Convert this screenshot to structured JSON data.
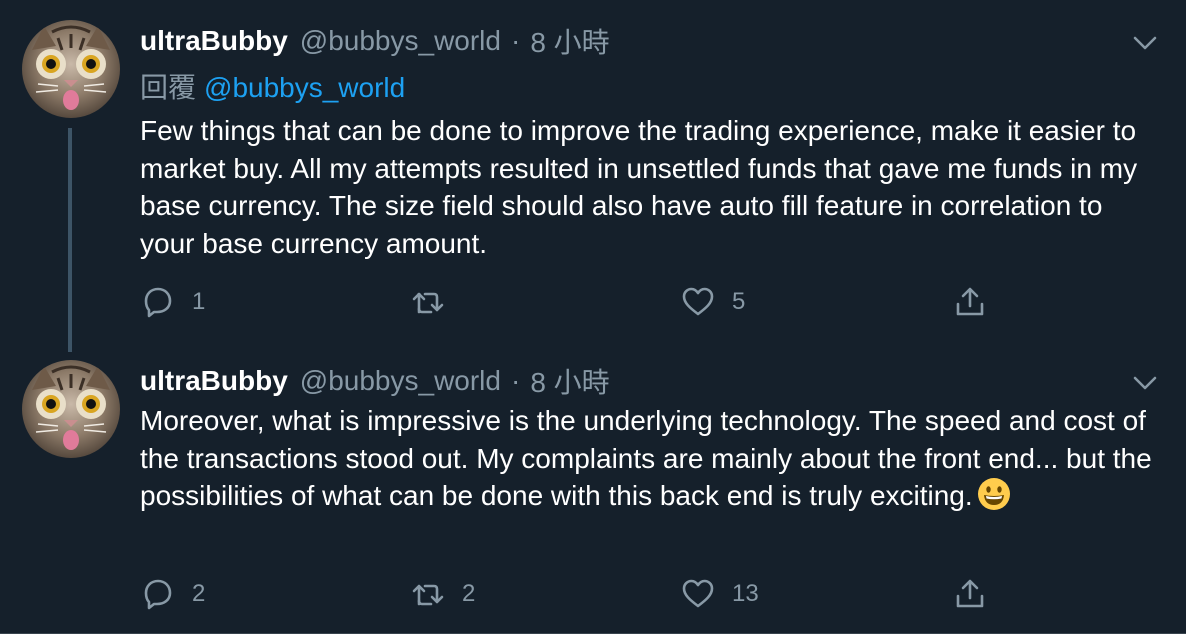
{
  "tweets": [
    {
      "author_name": "ultraBubby",
      "handle": "@bubbys_world",
      "separator": "·",
      "time": "8 小時",
      "reply_label": "回覆",
      "reply_to": "@bubbys_world",
      "text": "Few things that can be done to improve the trading experience, make it easier to market buy. All my attempts resulted in unsettled funds that gave me funds in my base currency. The size field should also have auto fill feature in correlation to your base currency amount.",
      "reply_count": "1",
      "retweet_count": "",
      "like_count": "5"
    },
    {
      "author_name": "ultraBubby",
      "handle": "@bubbys_world",
      "separator": "·",
      "time": "8 小時",
      "text": "Moreover, what is impressive is the underlying technology. The speed and cost of the transactions stood out. My complaints are mainly about the front end... but the possibilities of what can be done with this back end is truly exciting.",
      "emoji": "grinning-face-emoji",
      "reply_count": "2",
      "retweet_count": "2",
      "like_count": "13"
    }
  ],
  "icons": {
    "reply": "reply-icon",
    "retweet": "retweet-icon",
    "like": "heart-icon",
    "share": "share-icon",
    "more": "chevron-down-icon"
  },
  "colors": {
    "background": "#15202b",
    "primary_text": "#ffffff",
    "secondary_text": "#8899a6",
    "link": "#1da1f2",
    "thread_line": "#3d5466"
  }
}
